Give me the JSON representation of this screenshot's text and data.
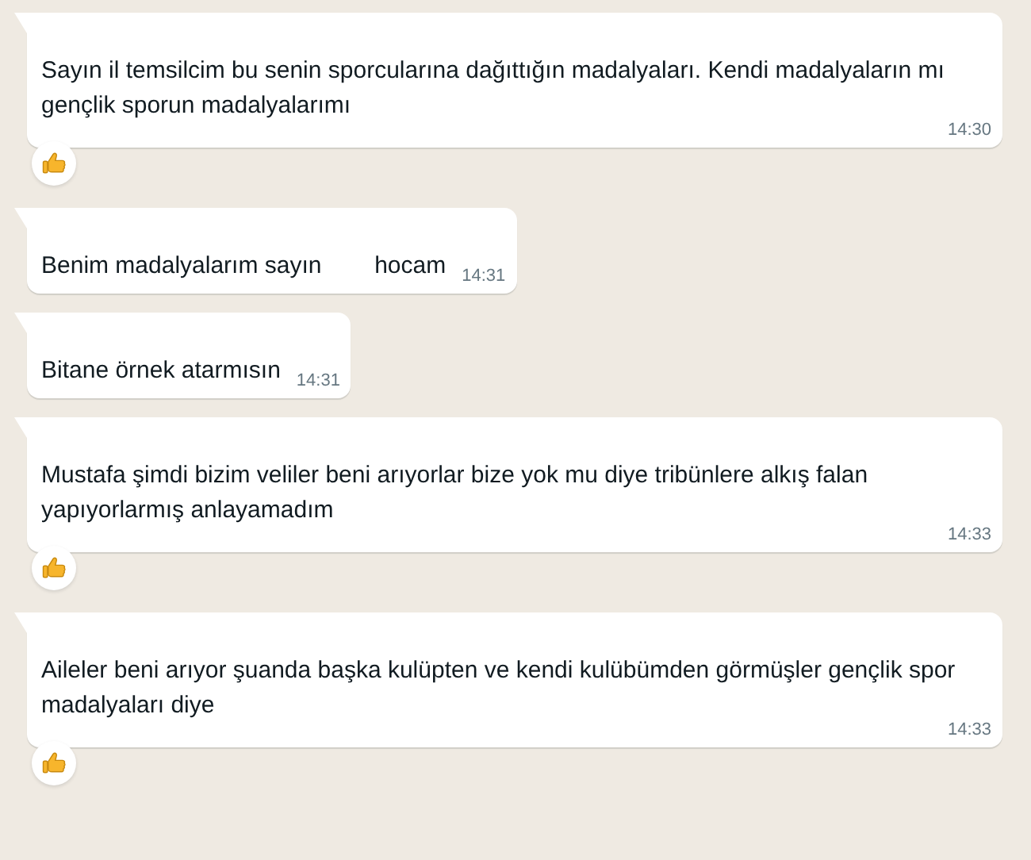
{
  "messages": [
    {
      "text": "Sayın il temsilcim bu senin sporcularına dağıttığın madalyaları. Kendi madalyaların mı gençlik sporun madalyalarımı",
      "time": "14:30",
      "liked": true
    },
    {
      "text": "Benim madalyalarım sayın        hocam",
      "time": "14:31",
      "liked": false
    },
    {
      "text": "Bitane örnek atarmısın",
      "time": "14:31",
      "liked": false
    },
    {
      "text": "Mustafa şimdi bizim veliler beni arıyorlar bize yok mu diye tribünlere alkış falan yapıyorlarmış anlayamadım",
      "time": "14:33",
      "liked": true
    },
    {
      "text": "Aileler beni arıyor şuanda başka kulüpten ve kendi kulübümden görmüşler gençlik spor madalyaları diye",
      "time": "14:33",
      "liked": true
    }
  ]
}
